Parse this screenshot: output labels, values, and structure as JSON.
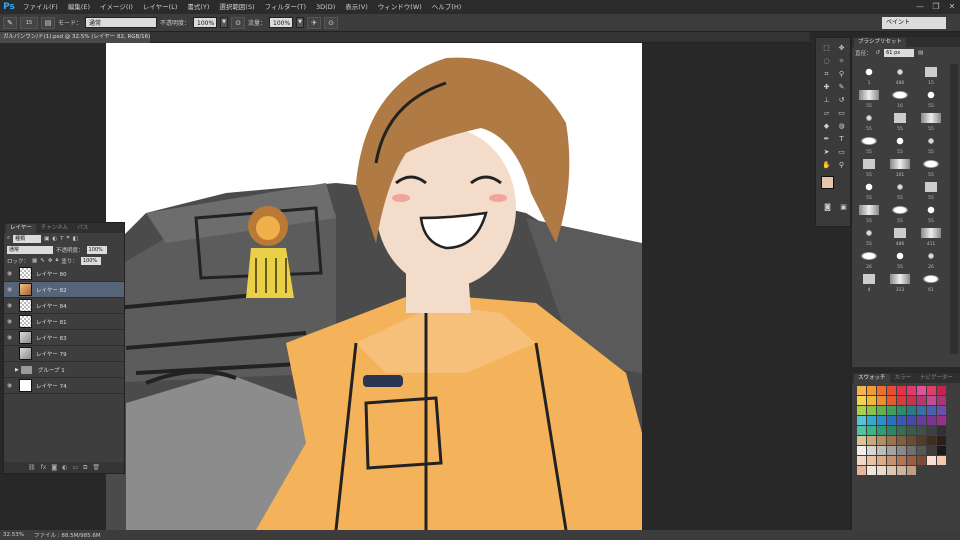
{
  "app": {
    "logo": "Ps"
  },
  "menu": [
    "ファイル(F)",
    "編集(E)",
    "イメージ(I)",
    "レイヤー(L)",
    "書式(Y)",
    "選択範囲(S)",
    "フィルター(T)",
    "3D(D)",
    "表示(V)",
    "ウィンドウ(W)",
    "ヘルプ(H)"
  ],
  "window_controls": [
    "—",
    "❐",
    "✕"
  ],
  "options": {
    "brush_size": "15",
    "mode_label": "モード：",
    "mode_value": "通常",
    "opacity_label": "不透明度：",
    "opacity_value": "100%",
    "flow_label": "流量：",
    "flow_value": "100%",
    "workspace": "ペイント"
  },
  "document_tab": "ガルパンウン/ド(1).psd @ 32.5% (レイヤー 82, RGB/16) *",
  "layers_panel": {
    "tabs": [
      "レイヤー",
      "チャンネル",
      "パス"
    ],
    "kind_filter": "種類",
    "blend_mode": "通常",
    "opacity_label": "不透明度：",
    "opacity_value": "100%",
    "lock_label": "ロック：",
    "fill_label": "塗り：",
    "fill_value": "100%",
    "layers": [
      {
        "name": "レイヤー 80",
        "thumb": "chk",
        "visible": true,
        "selected": false
      },
      {
        "name": "レイヤー 82",
        "thumb": "color",
        "visible": true,
        "selected": true
      },
      {
        "name": "レイヤー 84",
        "thumb": "chk",
        "visible": true,
        "selected": false
      },
      {
        "name": "レイヤー 81",
        "thumb": "chk",
        "visible": true,
        "selected": false
      },
      {
        "name": "レイヤー 83",
        "thumb": "sketch",
        "visible": true,
        "selected": false
      },
      {
        "name": "レイヤー 79",
        "thumb": "sketch",
        "visible": false,
        "selected": false
      },
      {
        "name": "グループ 1",
        "thumb": "folder",
        "visible": false,
        "selected": false
      },
      {
        "name": "レイヤー 74",
        "thumb": "white",
        "visible": true,
        "selected": false
      }
    ],
    "footer_icons": [
      "link-icon",
      "fx-icon",
      "mask-icon",
      "adjustment-icon",
      "folder-icon",
      "new-layer-icon",
      "trash-icon"
    ]
  },
  "brush_panel": {
    "title": "ブラシプリセット",
    "size_label": "直径：",
    "size_value": "61 px",
    "brushes": [
      "1",
      "486",
      "15",
      "55",
      "16",
      "55",
      "55",
      "55",
      "55",
      "55",
      "55",
      "55",
      "55",
      "101",
      "55",
      "55",
      "55",
      "55",
      "55",
      "55",
      "55",
      "55",
      "486",
      "411",
      "26",
      "55",
      "26",
      "4",
      "313",
      "61"
    ]
  },
  "swatch_panel": {
    "tabs": [
      "スウォッチ",
      "カラー",
      "ナビゲーター"
    ],
    "colors": [
      "#f7b34d",
      "#f39b2e",
      "#f06d2f",
      "#e84a33",
      "#e6304a",
      "#e33a6e",
      "#e44f97",
      "#dd3f6b",
      "#c8214f",
      "#f7d24c",
      "#f5b73a",
      "#ee8b2f",
      "#e85a2c",
      "#d93b3b",
      "#c7344f",
      "#b9366f",
      "#c44a93",
      "#a8357a",
      "#a9d04f",
      "#8bc34a",
      "#5fb34d",
      "#3f9f5b",
      "#2b8d6b",
      "#2a7b85",
      "#3a6fa4",
      "#4e5fb0",
      "#6a4fad",
      "#5cc2d6",
      "#35a9d0",
      "#2a8fca",
      "#2a6fc1",
      "#3a58b6",
      "#4b47a8",
      "#673c9b",
      "#7d3391",
      "#9a2f86",
      "#4fc59f",
      "#3fb388",
      "#2f9c73",
      "#2f8562",
      "#356f55",
      "#3d5b4d",
      "#41504a",
      "#3d3f46",
      "#2f2f35",
      "#d8c39a",
      "#c9a97a",
      "#b58e5f",
      "#9c744c",
      "#825e3e",
      "#6a4b33",
      "#543b2a",
      "#3f2d20",
      "#2b1f17",
      "#f0f0f0",
      "#d6d6d6",
      "#bdbdbd",
      "#a3a3a3",
      "#8a8a8a",
      "#707070",
      "#575757",
      "#3d3d3d",
      "#1a1a1a",
      "#f3d9c6",
      "#eac2a4",
      "#ddab88",
      "#c9906e",
      "#b37556",
      "#9a5f43",
      "#7f4b33",
      "#f9e0d0",
      "#f4c9b0",
      "#e9b497",
      "#f2e6dc",
      "#eadbcc",
      "#ddc7b2",
      "#cfb39a",
      "#c29f84"
    ]
  },
  "status": {
    "zoom": "32.53%",
    "file_info": "ファイル : 88.5M/985.6M"
  }
}
